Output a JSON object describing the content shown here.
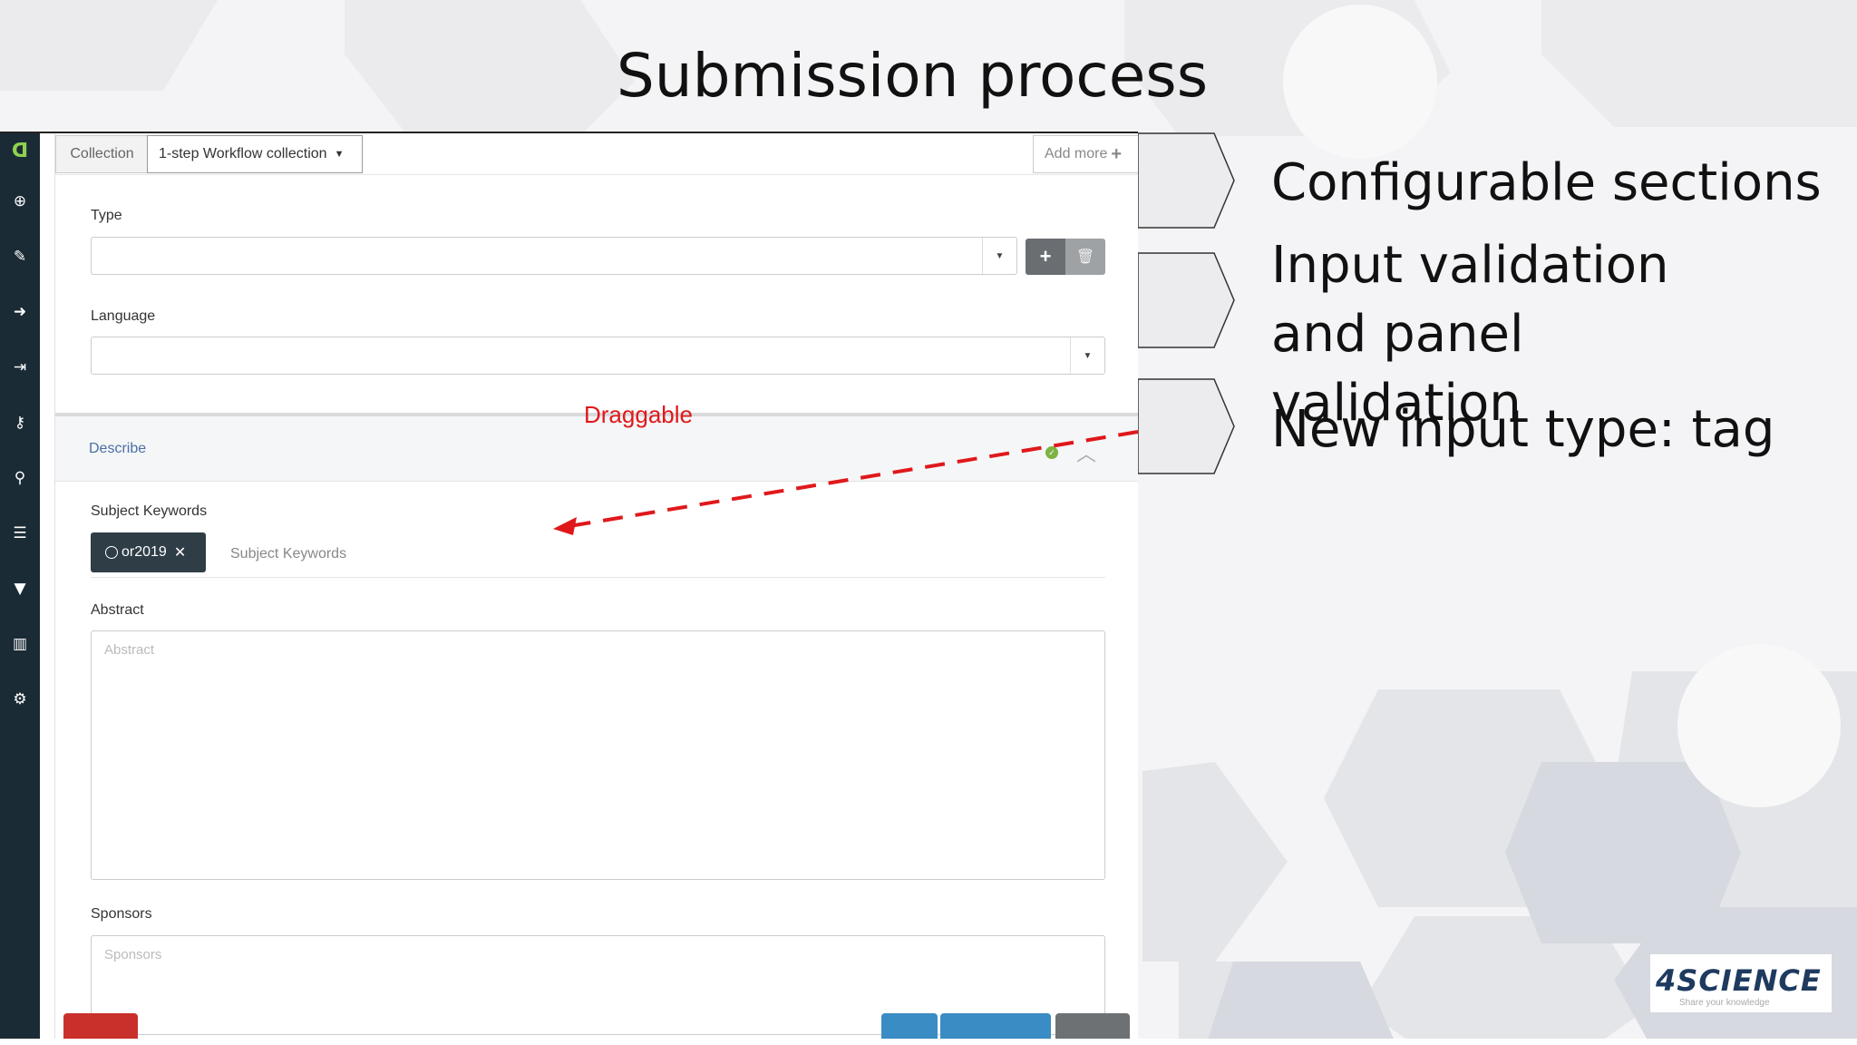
{
  "slide": {
    "title": "Submission process",
    "bullets": [
      "Configurable sections",
      "Input validation and panel validation",
      "New input type: tag"
    ],
    "annotation": "Draggable",
    "accent_color": "#e0181b"
  },
  "app": {
    "sidebar_icons": [
      "logo-icon",
      "plus-circle-icon",
      "pencil-icon",
      "sign-in-icon",
      "sign-out-icon",
      "key-icon",
      "search-icon",
      "list-icon",
      "filter-icon",
      "bar-chart-icon",
      "cogs-icon"
    ],
    "header": {
      "collection_label": "Collection",
      "collection_value": "1-step Workflow collection",
      "add_more": "Add more"
    },
    "fields": {
      "type_label": "Type",
      "language_label": "Language"
    },
    "panel": {
      "title": "Describe",
      "subject_label": "Subject Keywords",
      "tag_value": "or2019",
      "subject_placeholder": "Subject Keywords",
      "abstract_label": "Abstract",
      "abstract_placeholder": "Abstract",
      "sponsors_label": "Sponsors",
      "sponsors_placeholder": "Sponsors"
    }
  },
  "brand": {
    "name": "4SCIENCE",
    "tagline": "Share your knowledge"
  }
}
